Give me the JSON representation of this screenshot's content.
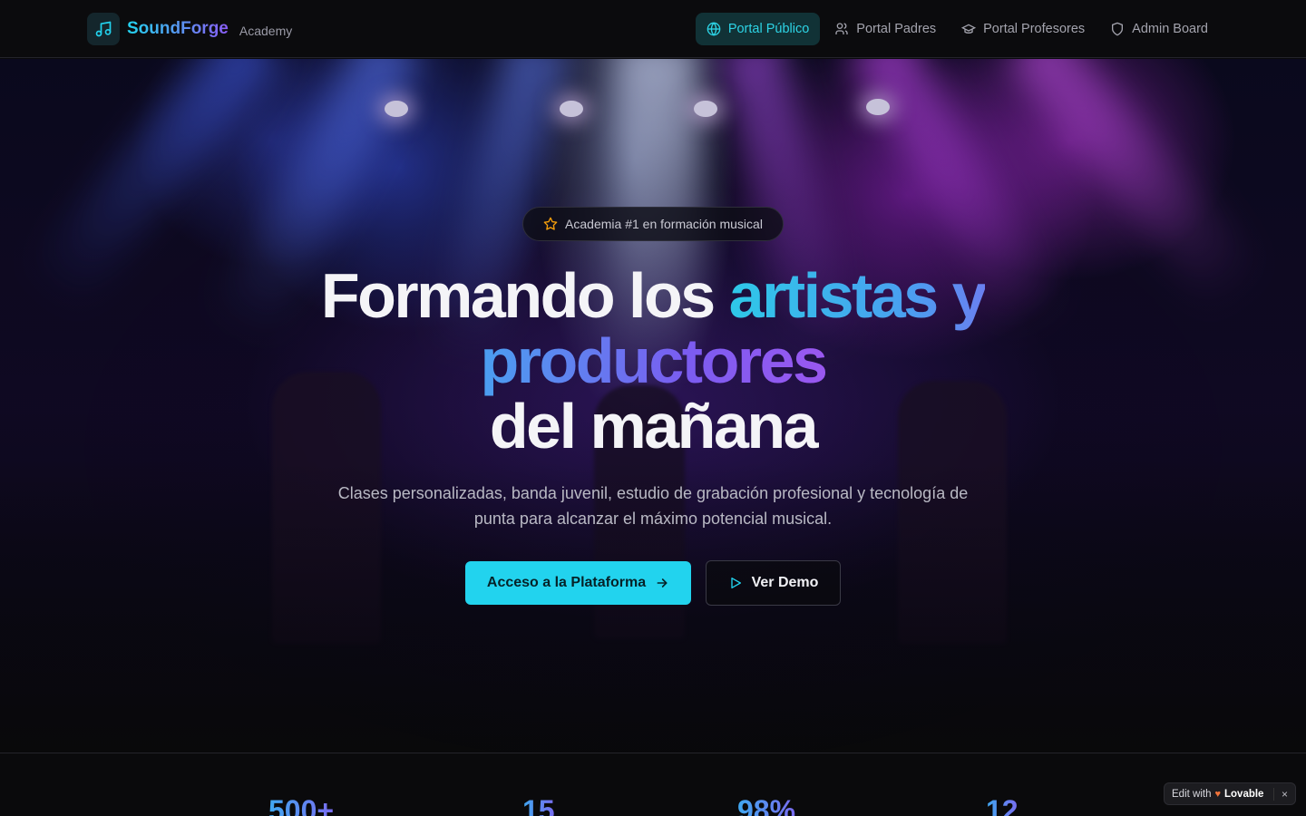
{
  "brand": {
    "name": "SoundForge",
    "sub": "Academy",
    "icon": "music-note-icon"
  },
  "nav": {
    "items": [
      {
        "label": "Portal Público",
        "icon": "globe-icon",
        "active": true
      },
      {
        "label": "Portal Padres",
        "icon": "users-icon",
        "active": false
      },
      {
        "label": "Portal Profesores",
        "icon": "graduation-cap-icon",
        "active": false
      },
      {
        "label": "Admin Board",
        "icon": "shield-icon",
        "active": false
      }
    ]
  },
  "hero": {
    "badge": "Academia #1 en formación musical",
    "headline": {
      "part1": "Formando los ",
      "part2": "artistas y",
      "part3": "productores",
      "part4": "del mañana"
    },
    "subtitle": "Clases personalizadas, banda juvenil, estudio de grabación profesional y tecnología de punta para alcanzar el máximo potencial musical.",
    "primary_cta": "Acceso a la Plataforma",
    "secondary_cta": "Ver Demo"
  },
  "stats": [
    "500+",
    "15",
    "98%",
    "12"
  ],
  "lovable": {
    "prefix": "Edit with",
    "brand": "Lovable",
    "close": "×"
  },
  "colors": {
    "accent": "#22d3ee",
    "purple": "#8b5cf6",
    "background": "#0a0a0c"
  }
}
